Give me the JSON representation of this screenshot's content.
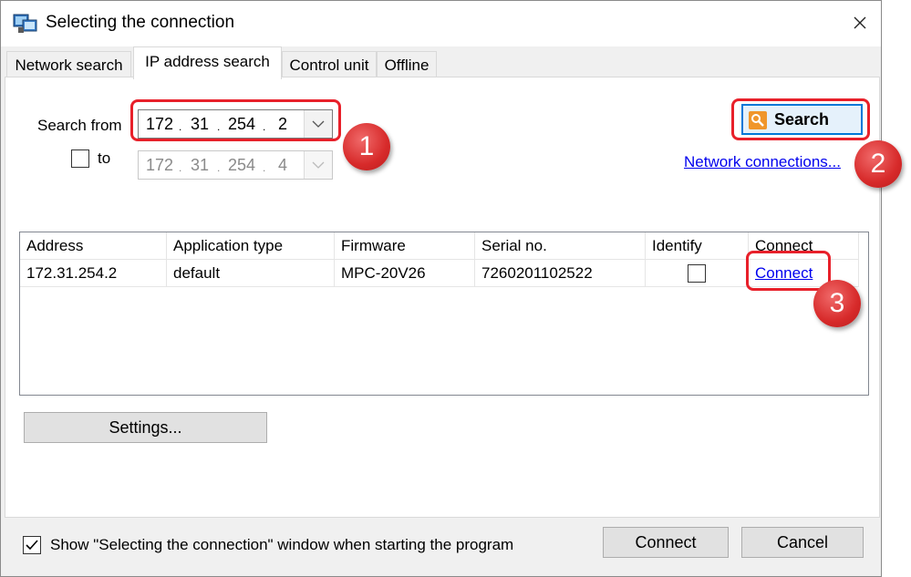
{
  "window": {
    "title": "Selecting the connection"
  },
  "tabs": [
    {
      "label": "Network search"
    },
    {
      "label": "IP address search"
    },
    {
      "label": "Control unit"
    },
    {
      "label": "Offline"
    }
  ],
  "search": {
    "from_label": "Search from",
    "to_label": "to",
    "from_ip": [
      "172",
      "31",
      "254",
      "2"
    ],
    "to_ip": [
      "172",
      "31",
      "254",
      "4"
    ],
    "search_button": "Search",
    "network_link": "Network connections..."
  },
  "table": {
    "columns": [
      "Address",
      "Application type",
      "Firmware",
      "Serial no.",
      "Identify",
      "Connect"
    ],
    "rows": [
      {
        "address": "172.31.254.2",
        "app_type": "default",
        "firmware": "MPC-20V26",
        "serial": "7260201102522",
        "connect": "Connect"
      }
    ]
  },
  "settings_button": "Settings...",
  "footer": {
    "show_window_label": "Show \"Selecting the connection\" window when starting the program",
    "connect_button": "Connect",
    "cancel_button": "Cancel"
  },
  "annotations": [
    "1",
    "2",
    "3"
  ],
  "colors": {
    "accent_red": "#e8202a",
    "link_blue": "#0000ee",
    "search_blue": "#0078d7"
  }
}
